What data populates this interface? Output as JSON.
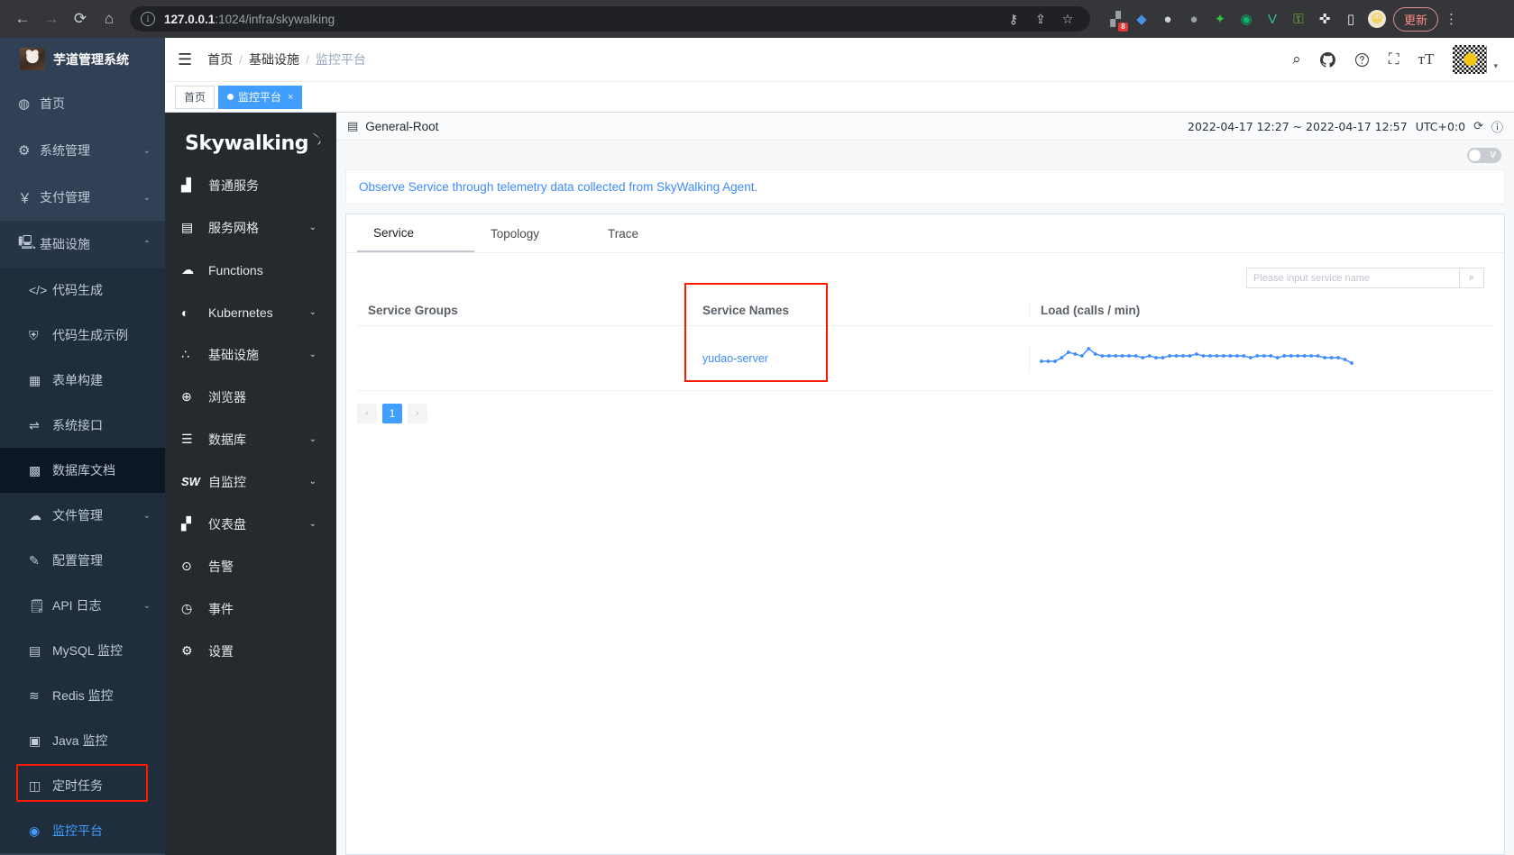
{
  "browser": {
    "back_icon": "←",
    "forward_icon": "→",
    "reload_icon": "⟳",
    "home_icon": "⌂",
    "url_host": "127.0.0.1",
    "url_path": ":1024/infra/skywalking",
    "key_icon": "⚷",
    "share_icon": "⇪",
    "star_icon": "☆",
    "extension_badge": "8",
    "update_label": "更新",
    "kebab_icon": "⋮"
  },
  "sidebar": {
    "logo_title": "芋道管理系统",
    "items": [
      {
        "icon": "◍",
        "label": "首页",
        "arrow": ""
      },
      {
        "icon": "⚙",
        "label": "系统管理",
        "arrow": "⌄"
      },
      {
        "icon": "￥",
        "label": "支付管理",
        "arrow": "⌄"
      },
      {
        "icon": "🖳",
        "label": "基础设施",
        "arrow": "⌃"
      }
    ],
    "sub_items": [
      {
        "icon": "</>",
        "label": "代码生成",
        "arrow": ""
      },
      {
        "icon": "⛨",
        "label": "代码生成示例",
        "arrow": ""
      },
      {
        "icon": "▦",
        "label": "表单构建",
        "arrow": ""
      },
      {
        "icon": "⇌",
        "label": "系统接口",
        "arrow": ""
      },
      {
        "icon": "▩",
        "label": "数据库文档",
        "arrow": ""
      },
      {
        "icon": "☁",
        "label": "文件管理",
        "arrow": "⌄"
      },
      {
        "icon": "✎",
        "label": "配置管理",
        "arrow": ""
      },
      {
        "icon": "🗒",
        "label": "API 日志",
        "arrow": "⌄"
      },
      {
        "icon": "▤",
        "label": "MySQL 监控",
        "arrow": ""
      },
      {
        "icon": "≋",
        "label": "Redis 监控",
        "arrow": ""
      },
      {
        "icon": "▣",
        "label": "Java 监控",
        "arrow": ""
      },
      {
        "icon": "◫",
        "label": "定时任务",
        "arrow": ""
      },
      {
        "icon": "◉",
        "label": "监控平台",
        "arrow": ""
      }
    ]
  },
  "navbar": {
    "hamburger_icon": "☰",
    "breadcrumb": [
      "首页",
      "基础设施",
      "监控平台"
    ],
    "separator": "/",
    "icons": [
      "search-icon",
      "github-icon",
      "help-icon",
      "fullscreen-icon",
      "font-size-icon"
    ],
    "search_glyph": "⌕",
    "help_glyph": "?",
    "fullscreen_glyph": "⛶",
    "fontsize_glyph": "тT",
    "caret": "▾"
  },
  "tabs": [
    {
      "label": "首页",
      "selected": false,
      "closable": false
    },
    {
      "label": "监控平台",
      "selected": true,
      "closable": true,
      "close_glyph": "×"
    }
  ],
  "skywalking": {
    "logo": "Skywalking",
    "menu": [
      {
        "icon": "▟",
        "label": "普通服务",
        "arrow": ""
      },
      {
        "icon": "▤",
        "label": "服务网格",
        "arrow": "⌄"
      },
      {
        "icon": "☁",
        "label": "Functions",
        "arrow": ""
      },
      {
        "icon": "◐",
        "label": "Kubernetes",
        "arrow": "⌄"
      },
      {
        "icon": "∴",
        "label": "基础设施",
        "arrow": "⌄"
      },
      {
        "icon": "⊕",
        "label": "浏览器",
        "arrow": ""
      },
      {
        "icon": "☰",
        "label": "数据库",
        "arrow": "⌄"
      },
      {
        "icon": "SW",
        "label": "自监控",
        "arrow": "⌄"
      },
      {
        "icon": "▞",
        "label": "仪表盘",
        "arrow": "⌄"
      },
      {
        "icon": "⊙",
        "label": "告警",
        "arrow": ""
      },
      {
        "icon": "◷",
        "label": "事件",
        "arrow": ""
      },
      {
        "icon": "⚙",
        "label": "设置",
        "arrow": ""
      }
    ],
    "topbar": {
      "root_icon": "▤",
      "root_name": "General-Root",
      "time_range": "2022-04-17 12:27 ~ 2022-04-17 12:57",
      "timezone": "UTC+0:0",
      "refresh_icon": "⟳",
      "info_icon": "ⓘ"
    },
    "toggle": {
      "label": "V",
      "state": "off"
    },
    "notice": "Observe Service through telemetry data collected from SkyWalking Agent.",
    "content_tabs": [
      {
        "label": "Service",
        "active": true
      },
      {
        "label": "Topology",
        "active": false
      },
      {
        "label": "Trace",
        "active": false
      }
    ],
    "search": {
      "placeholder": "Please input service name",
      "value": "",
      "icon": "⌕"
    },
    "table": {
      "headers": [
        "Service Groups",
        "Service Names",
        "Load (calls / min)"
      ],
      "rows": [
        {
          "group": "",
          "name": "yudao-server"
        }
      ]
    },
    "pagination": {
      "prev": "‹",
      "pages": [
        "1"
      ],
      "next": "›",
      "current": "1"
    }
  },
  "chart_data": {
    "type": "line",
    "title": "Load (calls / min)",
    "xlabel": "",
    "ylabel": "calls / min",
    "grid": false,
    "legend": null,
    "color": "#3d8bfd",
    "x": [
      0,
      1,
      2,
      3,
      4,
      5,
      6,
      7,
      8,
      9,
      10,
      11,
      12,
      13,
      14,
      15,
      16,
      17,
      18,
      19,
      20,
      21,
      22,
      23,
      24,
      25,
      26,
      27,
      28,
      29,
      30,
      31,
      32,
      33,
      34,
      35,
      36,
      37,
      38,
      39,
      40,
      41,
      42,
      43,
      44,
      45,
      46
    ],
    "values": [
      2,
      2,
      2,
      4,
      7,
      6,
      5,
      9,
      6,
      5,
      5,
      5,
      5,
      5,
      5,
      4,
      5,
      4,
      4,
      5,
      5,
      5,
      5,
      6,
      5,
      5,
      5,
      5,
      5,
      5,
      5,
      4,
      5,
      5,
      5,
      4,
      5,
      5,
      5,
      5,
      5,
      5,
      4,
      4,
      4,
      3,
      1
    ],
    "ylim": [
      0,
      10
    ]
  }
}
